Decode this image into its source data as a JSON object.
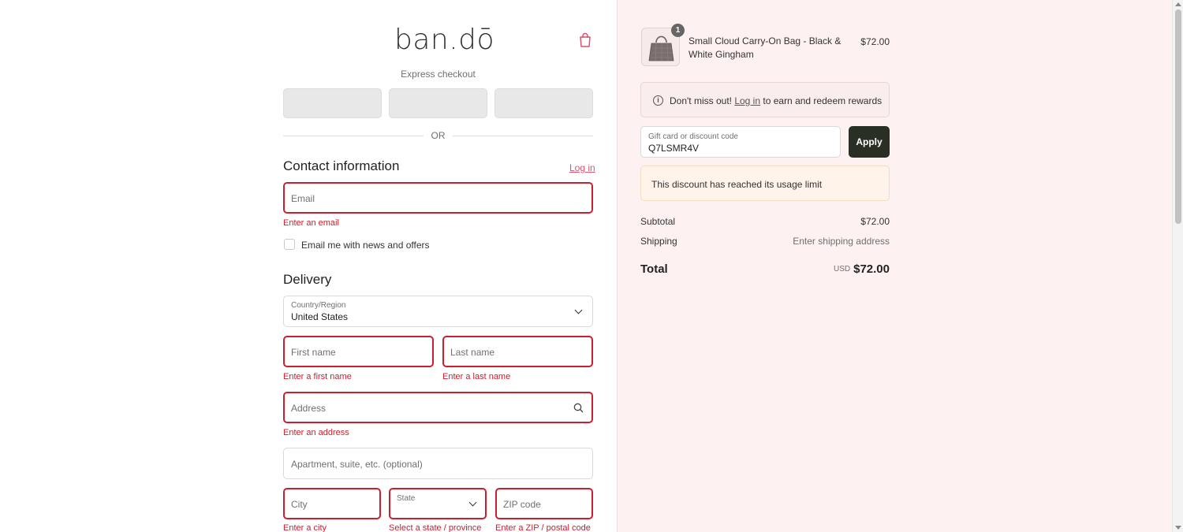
{
  "header": {
    "logo": "ban.dō",
    "cart_icon": "shopping-bag-icon"
  },
  "express": {
    "label": "Express checkout",
    "or_label": "OR"
  },
  "contact": {
    "title": "Contact information",
    "login_link": "Log in",
    "email_placeholder": "Email",
    "email_error": "Enter an email",
    "newsletter_label": "Email me with news and offers"
  },
  "delivery": {
    "title": "Delivery",
    "country_label": "Country/Region",
    "country_value": "United States",
    "first_name_placeholder": "First name",
    "first_name_error": "Enter a first name",
    "last_name_placeholder": "Last name",
    "last_name_error": "Enter a last name",
    "address_placeholder": "Address",
    "address_error": "Enter an address",
    "apartment_placeholder": "Apartment, suite, etc. (optional)",
    "city_placeholder": "City",
    "city_error": "Enter a city",
    "state_label": "State",
    "state_error": "Select a state / province",
    "zip_placeholder": "ZIP code",
    "zip_error": "Enter a ZIP / postal code"
  },
  "summary": {
    "item": {
      "quantity": "1",
      "name": "Small Cloud Carry-On Bag - Black & White Gingham",
      "price": "$72.00"
    },
    "rewards": {
      "prefix": "Don't miss out!",
      "link": "Log in",
      "suffix": "to earn and redeem rewards"
    },
    "discount": {
      "label": "Gift card or discount code",
      "value": "Q7LSMR4V",
      "apply_label": "Apply",
      "warning": "This discount has reached its usage limit"
    },
    "subtotal_label": "Subtotal",
    "subtotal_value": "$72.00",
    "shipping_label": "Shipping",
    "shipping_value": "Enter shipping address",
    "total_label": "Total",
    "total_currency": "USD",
    "total_value": "$72.00"
  },
  "colors": {
    "error": "#c9202f",
    "link": "#d9546f",
    "apply_button": "#2a2f26",
    "summary_background": "#fef1f1"
  }
}
